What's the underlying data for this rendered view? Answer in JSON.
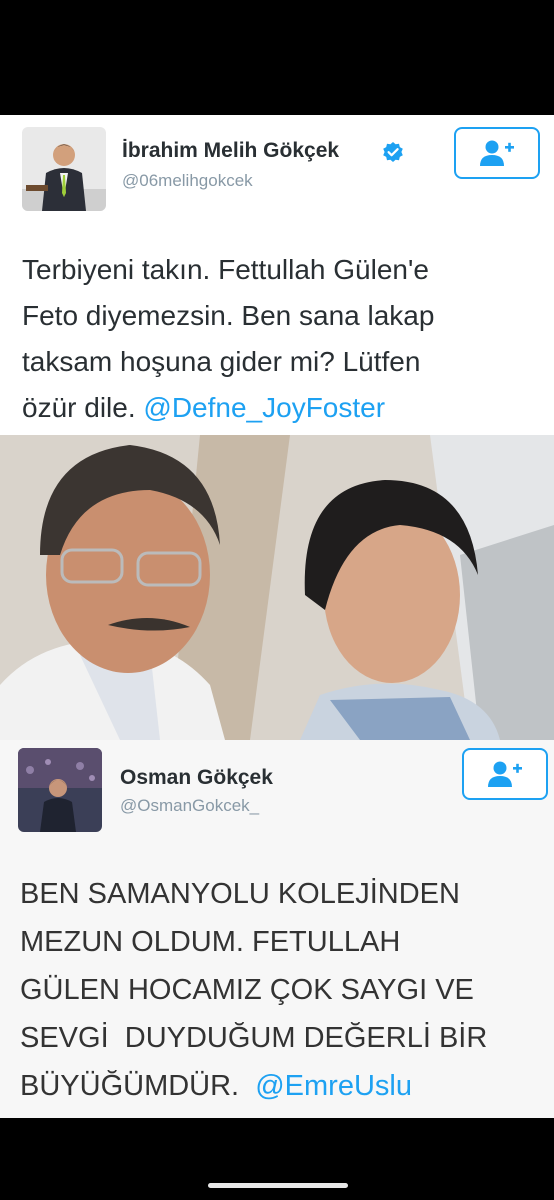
{
  "tweet1": {
    "name": "İbrahim Melih Gökçek",
    "handle": "@06melihgokcek",
    "verified_icon": "verified-badge-icon",
    "follow_icon": "add-user-icon",
    "text_lines": [
      "Terbiyeni takın. Fettullah Gülen'e",
      "Feto diyemezsin. Ben sana lakap",
      "taksam hoşuna gider mi? Lütfen"
    ],
    "text_last": "özür dile. ",
    "mention": "@Defne_JoyFoster"
  },
  "tweet2": {
    "name": "Osman Gökçek",
    "handle": "@OsmanGokcek_",
    "follow_icon": "add-user-icon",
    "text_lines": [
      "BEN SAMANYOLU KOLEJİNDEN",
      "MEZUN OLDUM. FETULLAH",
      "GÜLEN HOCAMIZ ÇOK SAYGI VE",
      "SEVGİ  DUYDUĞUM DEĞERLİ BİR"
    ],
    "text_last": "BÜYÜĞÜMDÜR.  ",
    "mention": "@EmreUslu"
  },
  "colors": {
    "twitter_blue": "#1da1f2",
    "text": "#292f33",
    "handle_gray": "#8899a6"
  }
}
